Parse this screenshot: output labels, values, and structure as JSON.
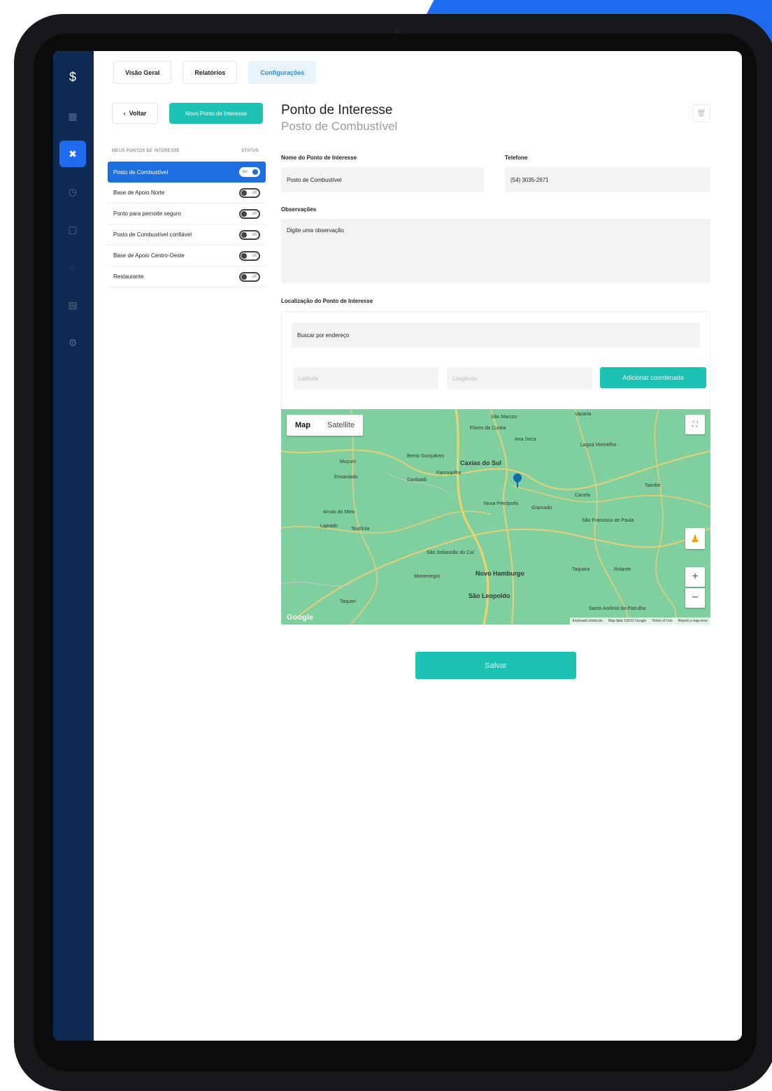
{
  "tabs": [
    {
      "label": "Visão Geral"
    },
    {
      "label": "Relatórios"
    },
    {
      "label": "Configurações"
    }
  ],
  "left": {
    "back_label": "Voltar",
    "new_button": "Novo Ponto de Interesse",
    "list_header": "MEUS PONTOS DE INTERESSE",
    "status_header": "STATUS",
    "items": [
      {
        "label": "Posto de Combustível",
        "status": "on"
      },
      {
        "label": "Base de Apoio Norte",
        "status": "off"
      },
      {
        "label": "Ponto para pernoite seguro",
        "status": "off"
      },
      {
        "label": "Posto de Combustível confiável",
        "status": "off"
      },
      {
        "label": "Base de Apoio Centro-Oeste",
        "status": "off"
      },
      {
        "label": "Restaurante",
        "status": "off"
      }
    ]
  },
  "form": {
    "title": "Ponto de Interesse",
    "subtitle": "Posto de Combustível",
    "name_label": "Nome do Ponto de Interesse",
    "name_value": "Posto de Combustível",
    "phone_label": "Telefone",
    "phone_value": "(54) 3035-2671",
    "obs_label": "Observações",
    "obs_placeholder": "Digite uma observação",
    "location_label": "Localização do Ponto de Interesse",
    "search_placeholder": "Buscar por endereço",
    "lat_placeholder": "Latitude",
    "lng_placeholder": "Longitude",
    "add_coord_label": "Adicionar coordenada",
    "save_label": "Salvar"
  },
  "map": {
    "type_map": "Map",
    "type_satellite": "Satellite",
    "zoom_in": "+",
    "zoom_out": "−",
    "logo": "Google",
    "attrib_shortcuts": "Keyboard shortcuts",
    "attrib_data": "Map data ©2022 Google",
    "attrib_terms": "Terms of Use",
    "attrib_report": "Report a map error",
    "cities": {
      "caxias": "Caxias do Sul",
      "novo_hamburgo": "Novo Hamburgo",
      "sao_leopoldo": "São Leopoldo",
      "sao_marcos": "São Marcos",
      "flores": "Flores da Cunha",
      "nova_petropolis": "Nova Petrópolis",
      "gramado": "Gramado",
      "canela": "Canela",
      "sao_francisco": "São Francisco de Paula",
      "farroupilha": "Farroupilha",
      "garibaldi": "Garibaldi",
      "bento": "Bento Gonçalves",
      "montenegro": "Montenegro",
      "taquara": "Taquara",
      "taquari": "Taquari",
      "lajeado": "Lajeado",
      "teutonia": "Teutônia",
      "sao_sebastiao": "São Sebastião do Caí",
      "rolante": "Rolante",
      "ana_seca": "Ana Seca",
      "vacaria": "Vacaria",
      "taimbe": "Taimbé",
      "santo_antonio": "Santo Antônio da Patrulha",
      "muçum": "Muçum",
      "encantado": "Encantado",
      "lagoa": "Lagoa Vermelha",
      "arroio": "Arroio do Meio"
    }
  },
  "colors": {
    "rail": "#0e2a52",
    "accent_blue": "#1d6fe0",
    "accent_teal": "#1cc2b3",
    "map_green": "#7fcf9f"
  },
  "icons": {
    "logo": "app-logo-icon",
    "dashboard": "grid-icon",
    "poi": "tools-icon",
    "clock": "clock-icon",
    "document": "document-icon",
    "chat": "chat-icon",
    "report": "report-icon",
    "settings": "gear-icon",
    "trash": "trash-icon"
  }
}
